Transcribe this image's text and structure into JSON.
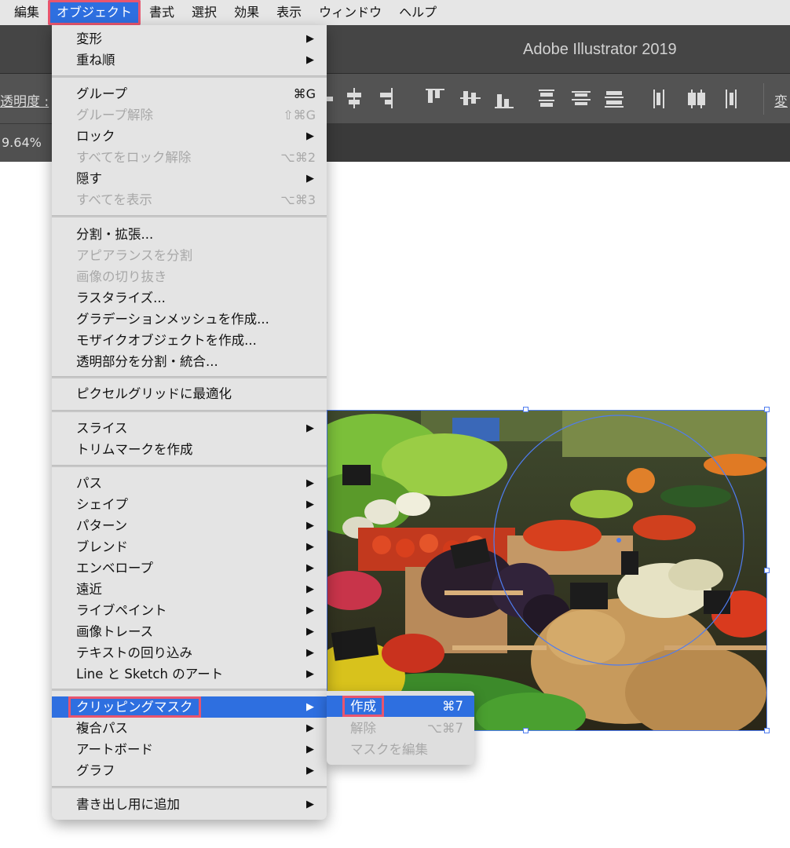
{
  "menubar": {
    "items": [
      "編集",
      "オブジェクト",
      "書式",
      "選択",
      "効果",
      "表示",
      "ウィンドウ",
      "ヘルプ"
    ],
    "open_index": 1
  },
  "app": {
    "title": "Adobe Illustrator 2019"
  },
  "control_bar": {
    "opacity_label": "透明度 :",
    "transform_label": "変",
    "align_icons": [
      "align-left-icon",
      "align-horizontal-center-icon",
      "align-right-icon",
      "align-top-icon",
      "align-vertical-center-icon",
      "align-bottom-icon",
      "distribute-top-icon",
      "distribute-vertical-center-icon",
      "distribute-bottom-icon",
      "distribute-left-icon",
      "distribute-horizontal-center-icon",
      "distribute-right-icon"
    ]
  },
  "document_tab": {
    "zoom": "9.64%"
  },
  "object_menu": {
    "groups": [
      [
        {
          "label": "変形",
          "submenu": true
        },
        {
          "label": "重ね順",
          "submenu": true
        }
      ],
      [
        {
          "label": "グループ",
          "shortcut": "⌘G"
        },
        {
          "label": "グループ解除",
          "shortcut": "⇧⌘G",
          "disabled": true
        },
        {
          "label": "ロック",
          "submenu": true
        },
        {
          "label": "すべてをロック解除",
          "shortcut": "⌥⌘2",
          "disabled": true
        },
        {
          "label": "隠す",
          "submenu": true
        },
        {
          "label": "すべてを表示",
          "shortcut": "⌥⌘3",
          "disabled": true
        }
      ],
      [
        {
          "label": "分割・拡張..."
        },
        {
          "label": "アピアランスを分割",
          "disabled": true
        },
        {
          "label": "画像の切り抜き",
          "disabled": true
        },
        {
          "label": "ラスタライズ..."
        },
        {
          "label": "グラデーションメッシュを作成..."
        },
        {
          "label": "モザイクオブジェクトを作成..."
        },
        {
          "label": "透明部分を分割・統合..."
        }
      ],
      [
        {
          "label": "ピクセルグリッドに最適化"
        }
      ],
      [
        {
          "label": "スライス",
          "submenu": true
        },
        {
          "label": "トリムマークを作成"
        }
      ],
      [
        {
          "label": "パス",
          "submenu": true
        },
        {
          "label": "シェイプ",
          "submenu": true
        },
        {
          "label": "パターン",
          "submenu": true
        },
        {
          "label": "ブレンド",
          "submenu": true
        },
        {
          "label": "エンベロープ",
          "submenu": true
        },
        {
          "label": "遠近",
          "submenu": true
        },
        {
          "label": "ライブペイント",
          "submenu": true
        },
        {
          "label": "画像トレース",
          "submenu": true
        },
        {
          "label": "テキストの回り込み",
          "submenu": true
        },
        {
          "label": "Line と Sketch のアート",
          "submenu": true
        }
      ],
      [
        {
          "label": "クリッピングマスク",
          "submenu": true,
          "highlighted": true
        },
        {
          "label": "複合パス",
          "submenu": true
        },
        {
          "label": "アートボード",
          "submenu": true
        },
        {
          "label": "グラフ",
          "submenu": true
        }
      ],
      [
        {
          "label": "書き出し用に追加",
          "submenu": true
        }
      ]
    ]
  },
  "clipping_mask_submenu": {
    "items": [
      {
        "label": "作成",
        "shortcut": "⌘7",
        "highlighted": true
      },
      {
        "label": "解除",
        "shortcut": "⌥⌘7",
        "disabled": true
      },
      {
        "label": "マスクを編集",
        "disabled": true
      }
    ]
  },
  "artwork": {
    "image": "vegetable-market-photo",
    "clip_shape": "circle"
  }
}
